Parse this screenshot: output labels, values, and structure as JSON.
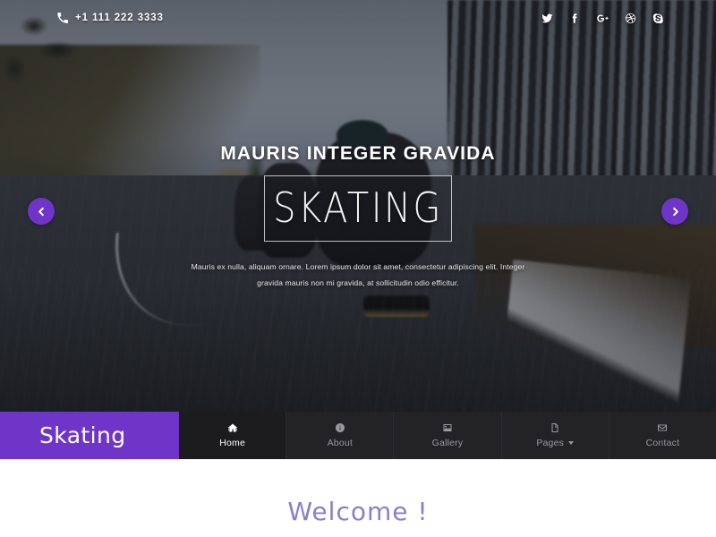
{
  "topbar": {
    "phone_icon": "phone-icon",
    "phone": "+1 111 222 3333",
    "socials": [
      {
        "name": "twitter",
        "icon": "twitter-icon",
        "label": "Twitter"
      },
      {
        "name": "facebook",
        "icon": "facebook-icon",
        "label": "Facebook"
      },
      {
        "name": "google-plus",
        "icon": "google-plus-icon",
        "label": "Google Plus"
      },
      {
        "name": "dribbble",
        "icon": "dribbble-icon",
        "label": "Dribbble"
      },
      {
        "name": "skype",
        "icon": "skype-icon",
        "label": "Skype"
      }
    ]
  },
  "hero": {
    "title": "MAURIS INTEGER GRAVIDA",
    "boxed_word": "SKATING",
    "description": "Mauris ex nulla, aliquam ornare. Lorem ipsum dolor sit amet, consectetur adipiscing elit. Integer gravida mauris non mi gravida, at sollicitudin odio efficitur.",
    "prev_label": "Previous slide",
    "next_label": "Next slide"
  },
  "nav": {
    "logo": "Skating",
    "items": [
      {
        "label": "Home",
        "icon": "home-icon",
        "active": true,
        "has_caret": false
      },
      {
        "label": "About",
        "icon": "info-icon",
        "active": false,
        "has_caret": false
      },
      {
        "label": "Gallery",
        "icon": "image-icon",
        "active": false,
        "has_caret": false
      },
      {
        "label": "Pages",
        "icon": "file-icon",
        "active": false,
        "has_caret": true
      },
      {
        "label": "Contact",
        "icon": "envelope-icon",
        "active": false,
        "has_caret": false
      }
    ]
  },
  "welcome": {
    "heading": "Welcome !"
  },
  "colors": {
    "accent_purple": "#6f35c9",
    "nav_dark": "#232326",
    "nav_active": "#1c1c1f",
    "welcome_text": "#8a7ed0",
    "muted_text": "#9a9a9f"
  }
}
